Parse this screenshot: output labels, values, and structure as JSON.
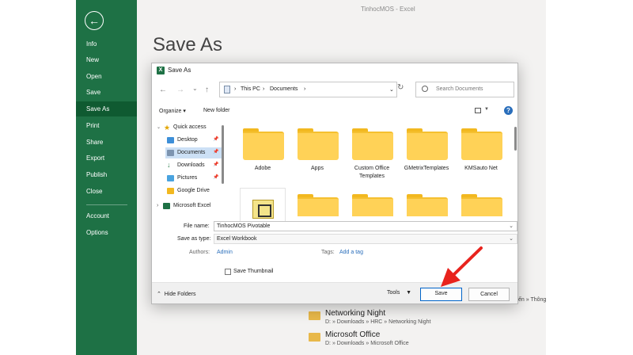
{
  "app": {
    "title": "TinhocMOS - Excel",
    "heading": "Save As"
  },
  "sidebar": {
    "back": "←",
    "items": [
      {
        "label": "Info"
      },
      {
        "label": "New"
      },
      {
        "label": "Open"
      },
      {
        "label": "Save"
      },
      {
        "label": "Save As",
        "active": true
      },
      {
        "label": "Print"
      },
      {
        "label": "Share"
      },
      {
        "label": "Export"
      },
      {
        "label": "Publish"
      },
      {
        "label": "Close"
      },
      {
        "label": "Account"
      },
      {
        "label": "Options"
      }
    ]
  },
  "recent": [
    {
      "name": "Networking Night",
      "path": "D: » Downloads » HRC » Networking Night"
    },
    {
      "name": "Microsoft Office",
      "path": "D: » Downloads » Microsoft Office"
    }
  ],
  "peek_text": "ến » Thông",
  "dialog": {
    "title": "Save As",
    "nav": {
      "back": "←",
      "forward": "→",
      "recent": "⌄",
      "up": "↑",
      "refresh": "↻"
    },
    "breadcrumb": [
      "This PC",
      "Documents"
    ],
    "search_placeholder": "Search Documents",
    "organize": "Organize ▾",
    "new_folder": "New folder",
    "help": "?",
    "navpane": {
      "quick_access": "Quick access",
      "items": [
        "Desktop",
        "Documents",
        "Downloads",
        "Pictures",
        "Google Drive"
      ],
      "microsoft_excel": "Microsoft Excel"
    },
    "folders": [
      "Adobe",
      "Apps",
      "Custom Office Templates",
      "GMetrixTemplates",
      "KMSauto Net"
    ],
    "file_name_label": "File name:",
    "file_name_value": "TinhocMOS Pivotable",
    "save_type_label": "Save as type:",
    "save_type_value": "Excel Workbook",
    "authors_label": "Authors:",
    "authors_value": "Admin",
    "tags_label": "Tags:",
    "tags_value": "Add a tag",
    "save_thumbnail": "Save Thumbnail",
    "hide_folders": "Hide Folders",
    "tools": "Tools",
    "save": "Save",
    "cancel": "Cancel"
  },
  "colors": {
    "excel_green": "#1e7145",
    "accent_blue": "#0064c8",
    "arrow_red": "#e8231d",
    "folder_yellow": "#ffd257"
  }
}
